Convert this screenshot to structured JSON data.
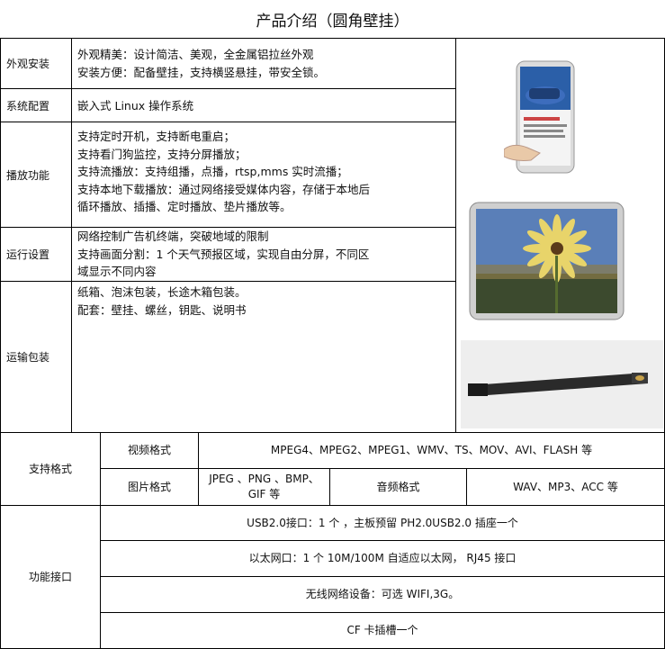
{
  "title": "产品介绍（圆角壁挂）",
  "rows": [
    {
      "label": "外观安装",
      "lines": [
        "外观精美：设计简洁、美观，全金属铝拉丝外观",
        "安装方便：配备壁挂，支持横竖悬挂，带安全锁。"
      ]
    },
    {
      "label": "系统配置",
      "lines": [
        "嵌入式 Linux 操作系统"
      ]
    },
    {
      "label": "播放功能",
      "lines": [
        "支持定时开机，支持断电重启；",
        "支持看门狗监控，支持分屏播放；",
        "支持流播放：支持组播，点播，rtsp,mms 实时流播；",
        "支持本地下载播放：通过网络接受媒体内容，存储于本地后",
        "循环播放、插播、定时播放、垫片播放等。"
      ]
    },
    {
      "label": "运行设置",
      "lines": [
        "网络控制广告机终端，突破地域的限制",
        "支持画面分割：1 个天气预报区域，实现自由分屏，不同区",
        "域显示不同内容"
      ]
    },
    {
      "label": "运输包装",
      "lines": [
        "纸箱、泡沫包装，长途木箱包装。",
        "配套：壁挂、螺丝，钥匙、说明书"
      ]
    }
  ],
  "formats": {
    "label": "支持格式",
    "video_label": "视频格式",
    "video_value": "MPEG4、MPEG2、MPEG1、WMV、TS、MOV、AVI、FLASH 等",
    "image_label": "图片格式",
    "image_value_1": "JPEG 、PNG 、BMP、",
    "image_value_2": "GIF 等",
    "audio_label": "音频格式",
    "audio_value": "WAV、MP3、ACC 等"
  },
  "interfaces": {
    "label": "功能接口",
    "items": [
      "USB2.0接口：1 个 ，主板预留 PH2.0USB2.0 插座一个",
      "以太网口：1 个 10M/100M 自适应以太网， RJ45 接口",
      "无线网络设备：可选 WIFI,3G。",
      "CF 卡插槽一个"
    ]
  },
  "colors": {
    "border": "#000000",
    "sky": "#5a7fb8",
    "flower": "#e8d46a",
    "screen_blue": "#2b5fa8"
  }
}
